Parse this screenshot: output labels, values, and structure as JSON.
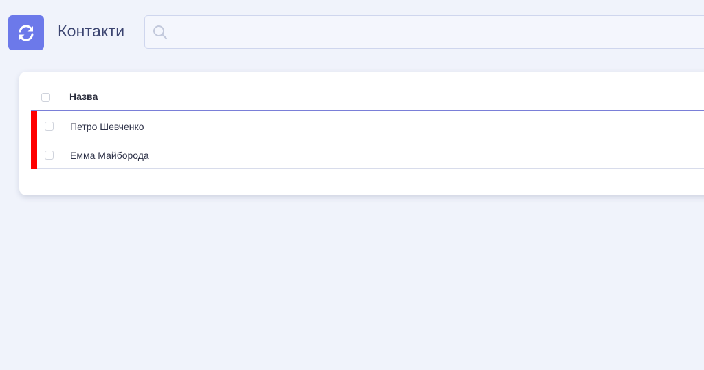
{
  "header": {
    "title": "Контакти",
    "refresh_icon": "refresh-icon",
    "search": {
      "value": "",
      "placeholder": "",
      "icon": "search-icon"
    }
  },
  "table": {
    "columns": [
      {
        "label": "Назва"
      }
    ],
    "rows": [
      {
        "name": "Петро Шевченко",
        "marker_color": "#ff0000"
      },
      {
        "name": "Емма Майборода",
        "marker_color": "#ff0000"
      }
    ],
    "header_underline_color": "#7a7fd8"
  },
  "colors": {
    "accent": "#6c79ea",
    "background": "#f0f3fb",
    "row_marker": "#ff0000"
  }
}
